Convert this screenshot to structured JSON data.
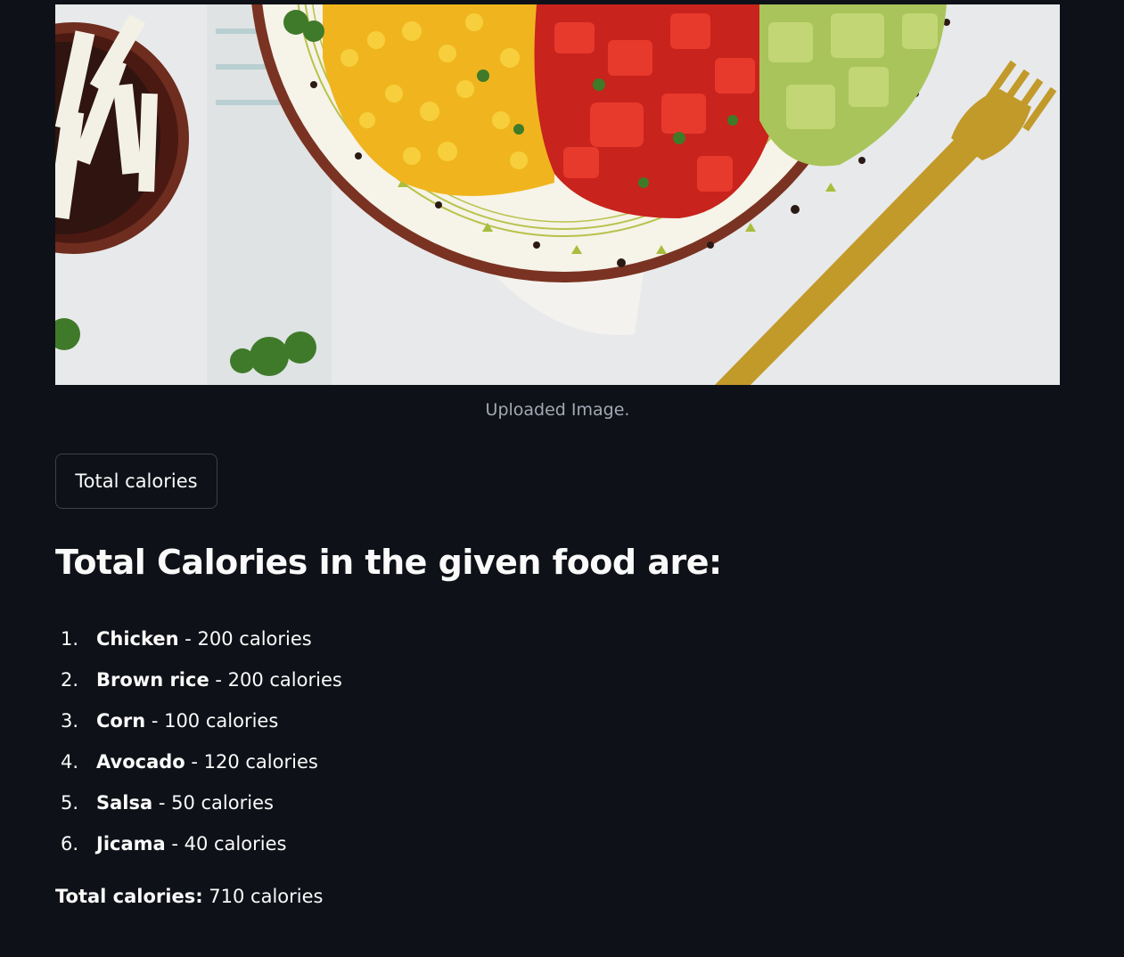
{
  "image": {
    "caption": "Uploaded Image.",
    "subject": "photo of a bowl with corn, tomato salsa and avocado, side bowl of jicama, gold fork"
  },
  "button": {
    "label": "Total calories"
  },
  "result": {
    "heading": "Total Calories in the given food are:",
    "items": [
      {
        "num": "1.",
        "name": "Chicken",
        "detail": " - 200 calories"
      },
      {
        "num": "2.",
        "name": "Brown rice",
        "detail": " - 200 calories"
      },
      {
        "num": "3.",
        "name": "Corn",
        "detail": " - 100 calories"
      },
      {
        "num": "4.",
        "name": "Avocado",
        "detail": " - 120 calories"
      },
      {
        "num": "5.",
        "name": "Salsa",
        "detail": " - 50 calories"
      },
      {
        "num": "6.",
        "name": "Jicama",
        "detail": " - 40 calories"
      }
    ],
    "total_label": "Total calories:",
    "total_value": " 710 calories"
  },
  "colors": {
    "background": "#0e1117",
    "text": "#fafafa",
    "caption": "#a3a8b4",
    "button_border": "#3d4048"
  }
}
